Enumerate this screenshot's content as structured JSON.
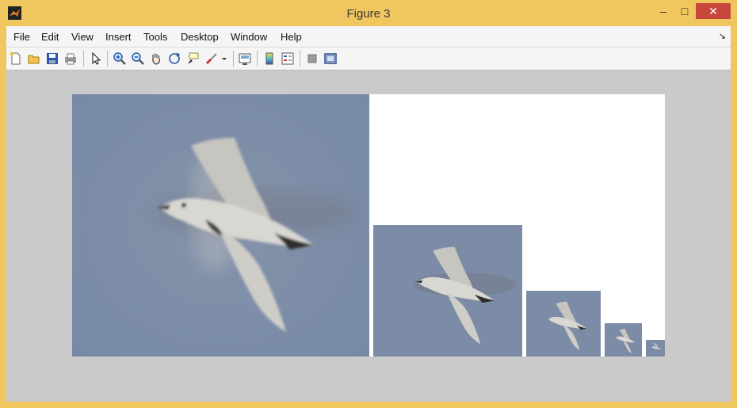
{
  "window": {
    "title": "Figure 3",
    "minimize": "–",
    "maximize": "□",
    "close": "✕"
  },
  "menu": {
    "items": [
      "File",
      "Edit",
      "View",
      "Insert",
      "Tools",
      "Desktop",
      "Window",
      "Help"
    ],
    "overflow": "↘"
  },
  "toolbar": {
    "buttons": [
      "new-figure-icon",
      "open-file-icon",
      "save-icon",
      "print-icon",
      "edit-plot-arrow-icon",
      "zoom-in-icon",
      "zoom-out-icon",
      "pan-hand-icon",
      "rotate-3d-icon",
      "data-cursor-icon",
      "brush-icon",
      "brush-dropdown-icon",
      "link-plot-icon",
      "insert-colorbar-icon",
      "insert-legend-icon",
      "hide-plot-tools-icon",
      "show-plot-tools-icon"
    ]
  },
  "figure": {
    "content": "image pyramid of a flying gull, 5 levels",
    "levels": 5
  }
}
